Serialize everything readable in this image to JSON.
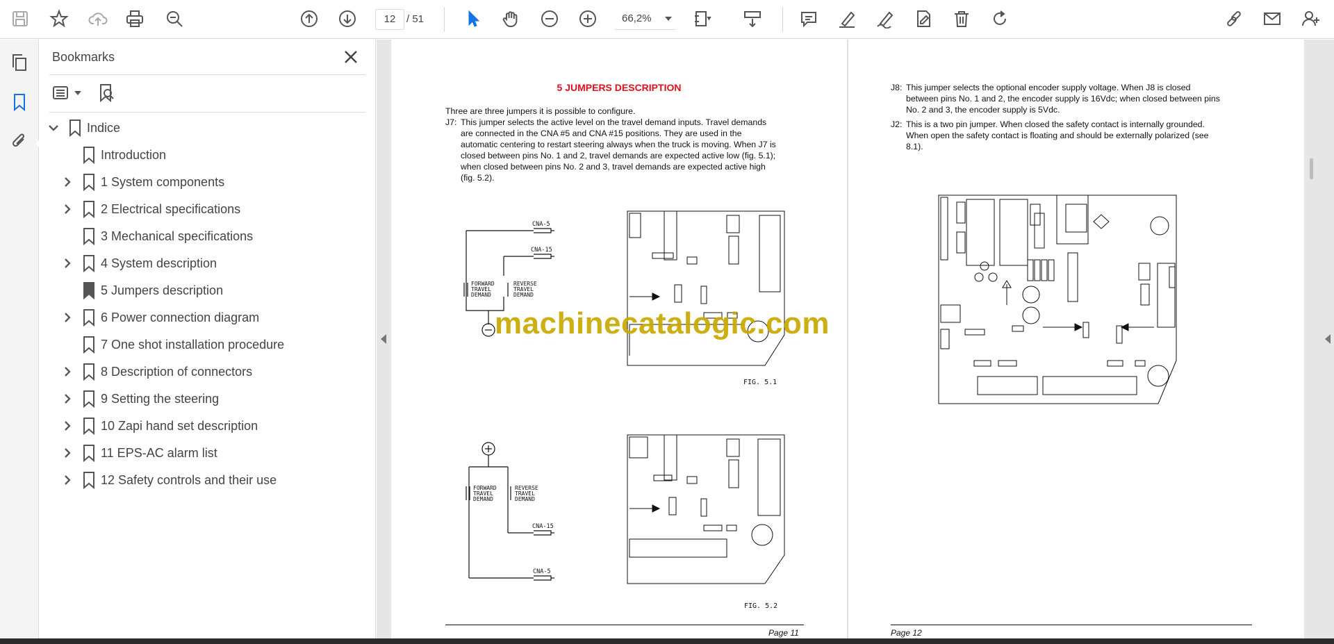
{
  "toolbar": {
    "current_page": "12",
    "total_pages": "/ 51",
    "zoom": "66,2%"
  },
  "bookmarks_panel": {
    "title": "Bookmarks",
    "items": [
      {
        "label": "Indice",
        "expanded": true,
        "level": 0
      },
      {
        "label": "Introduction",
        "level": 1
      },
      {
        "label": "1   System components",
        "level": 1,
        "has_children": true
      },
      {
        "label": "2   Electrical specifications",
        "level": 1,
        "has_children": true
      },
      {
        "label": "3   Mechanical specifications",
        "level": 1
      },
      {
        "label": "4   System description",
        "level": 1,
        "has_children": true
      },
      {
        "label": "5   Jumpers description",
        "level": 1,
        "selected": true
      },
      {
        "label": "6   Power connection diagram",
        "level": 1,
        "has_children": true
      },
      {
        "label": "7   One shot installation procedure",
        "level": 1
      },
      {
        "label": "8   Description of connectors",
        "level": 1,
        "has_children": true
      },
      {
        "label": "9   Setting the steering",
        "level": 1,
        "has_children": true
      },
      {
        "label": "10   Zapi hand set description",
        "level": 1,
        "has_children": true
      },
      {
        "label": "11   EPS-AC alarm list",
        "level": 1,
        "has_children": true
      },
      {
        "label": "12   Safety controls and their use",
        "level": 1,
        "has_children": true
      }
    ]
  },
  "page11": {
    "heading": "5 JUMPERS DESCRIPTION",
    "intro": "Three are three jumpers it is possible to configure.",
    "j7_tag": "J7:",
    "j7_lines": [
      "This jumper selects the active level on the travel demand inputs. Travel demands",
      "are connected in the CNA #5 and CNA #15 positions. They are used in the",
      "automatic centering to restart steering always when the truck is moving. When J7 is",
      "closed between pins No. 1 and 2, travel demands are expected active low (fig. 5.1);",
      "when closed between pins No. 2 and 3, travel demands are expected active high",
      "(fig. 5.2)."
    ],
    "fig1_label": "FIG. 5.1",
    "fig2_label": "FIG. 5.2",
    "footer": "Page 11",
    "labels": {
      "cna5": "CNA-5",
      "cna15": "CNA-15",
      "forward": "FORWARD",
      "reverse": "REVERSE",
      "travel": "TRAVEL",
      "demand": "DEMAND"
    }
  },
  "page12": {
    "j8_tag": "J8:",
    "j8_lines": [
      "This jumper selects the optional encoder supply voltage. When J8 is closed",
      "between pins No. 1 and 2, the encoder supply is 16Vdc; when closed between pins",
      "No. 2 and 3, the encoder supply is 5Vdc."
    ],
    "j2_tag": "J2:",
    "j2_lines": [
      "This is a two pin jumper. When closed the safety contact is internally grounded.",
      "When open the safety contact is floating and should be externally polarized (see",
      "8.1)."
    ],
    "footer": "Page 12"
  },
  "watermark": "machinecatalogic.com",
  "colors": {
    "accent": "#1473e6",
    "heading_red": "#e0101c",
    "watermark": "#c9a800"
  }
}
